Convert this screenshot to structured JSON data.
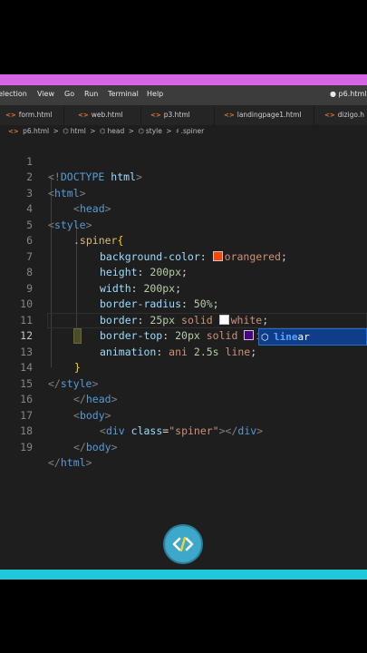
{
  "menubar": {
    "items": [
      "election",
      "View",
      "Go",
      "Run",
      "Terminal",
      "Help"
    ],
    "window_title": "● p6.html -"
  },
  "tabs": [
    {
      "label": "form.html",
      "icon": "html-file-icon"
    },
    {
      "label": "web.html",
      "icon": "html-file-icon"
    },
    {
      "label": "p3.html",
      "icon": "html-file-icon"
    },
    {
      "label": "landingpage1.html",
      "icon": "html-file-icon"
    },
    {
      "label": "dizigo.h",
      "icon": "html-file-icon"
    }
  ],
  "breadcrumb": {
    "file": "p6.html",
    "items": [
      "html",
      "head",
      "style",
      ".spiner"
    ],
    "separator": ">"
  },
  "code_lines": [
    {
      "num": "1",
      "text": "<!DOCTYPE html>"
    },
    {
      "num": "2",
      "text": "<html>"
    },
    {
      "num": "3",
      "text": "<head>"
    },
    {
      "num": "4",
      "text": "<style>"
    },
    {
      "num": "5",
      "text": ".spiner{"
    },
    {
      "num": "6",
      "text": "background-color: orangered;"
    },
    {
      "num": "7",
      "text": "height: 200px;"
    },
    {
      "num": "8",
      "text": "width: 200px;"
    },
    {
      "num": "9",
      "text": "border-radius: 50%;"
    },
    {
      "num": "10",
      "text": "border: 25px solid white;"
    },
    {
      "num": "11",
      "text": "border-top: 20px solid indigo;"
    },
    {
      "num": "12",
      "text": "animation: ani 2.5s line;"
    },
    {
      "num": "13",
      "text": "}"
    },
    {
      "num": "14",
      "text": "</style>"
    },
    {
      "num": "15",
      "text": "</head>"
    },
    {
      "num": "16",
      "text": "<body>"
    },
    {
      "num": "17",
      "text": "<div class=\"spiner\"></div>"
    },
    {
      "num": "18",
      "text": "</body>"
    },
    {
      "num": "19",
      "text": "</html>"
    }
  ],
  "tokens": {
    "doctype": "DOCTYPE",
    "html": "html",
    "head": "head",
    "style": "style",
    "selector": ".spiner",
    "brace_open": "{",
    "brace_close": "}",
    "p_bg": "background-color",
    "v_orangered": "orangered",
    "p_height": "height",
    "v_200px": "200px",
    "p_width": "width",
    "p_radius": "border-radius",
    "v_50": "50%",
    "p_border": "border",
    "v_25px": "25px",
    "v_solid": "solid",
    "v_white": "white",
    "p_border_top": "border-top",
    "v_20px": "20px",
    "v_indigo": "indigo",
    "p_animation": "animation",
    "v_ani": "ani",
    "v_25s": "2.5s",
    "v_line": "line",
    "body": "body",
    "div": "div",
    "class_attr": "class",
    "class_val": "\"spiner\""
  },
  "swatches": {
    "orangered": "#ff4500",
    "white": "#ffffff",
    "indigo": "#4b0082"
  },
  "suggestion": {
    "match": "line",
    "rest": "ar",
    "icon": "symbol-value-icon"
  },
  "logo": {
    "icon": "code-brackets-icon"
  },
  "colors": {
    "pink_bar": "#d766e6",
    "cyan_bar": "#1fc9da",
    "editor_bg": "#1e1e1e"
  }
}
